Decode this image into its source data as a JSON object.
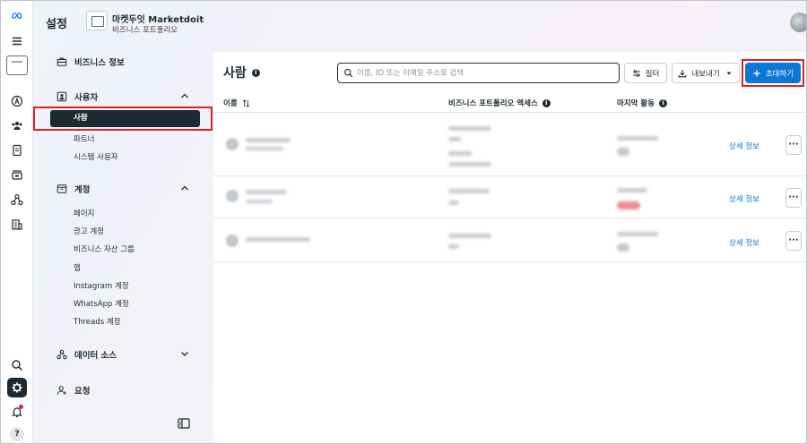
{
  "header": {
    "title": "설정",
    "business_name": "마켓두잇 Marketdoit",
    "business_sub": "비즈니스 포트폴리오"
  },
  "sidebar": {
    "business_info": "비즈니스 정보",
    "users_section": "사용자",
    "users_items": [
      "사람",
      "파트너",
      "시스템 사용자"
    ],
    "accounts_section": "계정",
    "accounts_items": [
      "페이지",
      "광고 계정",
      "비즈니스 자산 그룹",
      "앱",
      "Instagram 계정",
      "WhatsApp 계정",
      "Threads 계정"
    ],
    "data_sources": "데이터 소스",
    "requests": "요청"
  },
  "main": {
    "title": "사람",
    "search_placeholder": "이름, ID 또는 이메일 주소로 검색",
    "filter_label": "필터",
    "export_label": "내보내기",
    "invite_label": "초대하기",
    "columns": {
      "name": "이름",
      "access": "비즈니스 포트폴리오 액세스",
      "last_activity": "마지막 활동"
    },
    "rows": [
      {
        "detail_label": "상세 정보",
        "more_label": "···"
      },
      {
        "detail_label": "상세 정보",
        "more_label": "···"
      },
      {
        "detail_label": "상세 정보",
        "more_label": "···"
      }
    ]
  },
  "rail": {
    "help_label": "?"
  },
  "colors": {
    "accent": "#0a78d4",
    "highlight_box": "#e02020",
    "dark": "#1c2b33"
  }
}
